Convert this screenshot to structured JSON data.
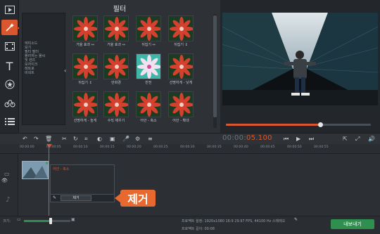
{
  "sidebar": {
    "tools": [
      {
        "name": "media-icon",
        "glyph": "▤"
      },
      {
        "name": "filter-wand-icon",
        "glyph": "✎"
      },
      {
        "name": "film-icon",
        "glyph": "▦"
      },
      {
        "name": "text-icon",
        "glyph": "T"
      },
      {
        "name": "sticker-star-icon",
        "glyph": "★"
      },
      {
        "name": "transition-icon",
        "glyph": "⟁"
      },
      {
        "name": "more-menu-icon",
        "glyph": "☰"
      }
    ]
  },
  "filters": {
    "title": "필터",
    "categories": [
      "에피소드",
      "보기",
      "필터 필터",
      "블러하는 물씨",
      "및 렌즈",
      "모자이크",
      "레트로",
      "비네트"
    ],
    "items": [
      {
        "label": "거울 효과 ↔"
      },
      {
        "label": "거울 효과 ↔"
      },
      {
        "label": "뒤집기 ↔"
      },
      {
        "label": "뒤집기 ↕"
      },
      {
        "label": "뒤집기 ↕"
      },
      {
        "label": "만화경"
      },
      {
        "label": "반전"
      },
      {
        "label": "선명하게 - 낮게"
      },
      {
        "label": "선명하게 - 높게"
      },
      {
        "label": "수직 채우기"
      },
      {
        "label": "어안 - 축소"
      },
      {
        "label": "어안 - 확대"
      }
    ]
  },
  "transport": {
    "time_dim": "00:00:",
    "time_hi": "05.100"
  },
  "ruler": {
    "ticks": [
      "00:00:00",
      "00:00:05",
      "00:00:10",
      "00:00:15",
      "00:00:20",
      "00:00:25",
      "00:00:30",
      "00:00:35",
      "00:00:40",
      "00:00:45",
      "00:00:50",
      "00:00:55"
    ]
  },
  "timeline": {
    "popup_item": "어안 - 축소",
    "remove_label": "제거"
  },
  "callouts": {
    "filter_label": "필터",
    "remove_label": "제거"
  },
  "status": {
    "zoom_label": "크기:",
    "project_settings": "프로젝트 설정:  1920x1080 16:9 29.97 FPS, 44100 Hz 스테레오",
    "project_length": "프로젝트 길이:  00:08",
    "export_label": "내보내기"
  },
  "colors": {
    "accent": "#d9572e",
    "callout": "#e8692f",
    "export": "#2f8f4f"
  },
  "playback": {
    "progress": 0.65
  }
}
